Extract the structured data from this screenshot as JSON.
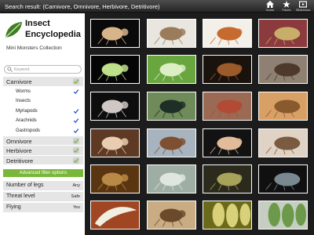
{
  "topbar": {
    "title": "Search result:  (Carnivore, Omnivore, Herbivore, Detritivore)",
    "buttons": [
      {
        "label": "Home",
        "icon": "home-icon"
      },
      {
        "label": "Faves",
        "icon": "star-icon"
      },
      {
        "label": "Slideshow",
        "icon": "slideshow-icon"
      }
    ]
  },
  "sidebar": {
    "logo_line1": "Insect",
    "logo_line2": "Encyclopedia",
    "collection": "Mini Monsters Collection",
    "search_placeholder": "Keyword",
    "categories": [
      {
        "label": "Carnivore",
        "checked": true,
        "type": "cat"
      },
      {
        "label": "Worms",
        "checked": true,
        "type": "sub"
      },
      {
        "label": "Insects",
        "checked": false,
        "type": "sub"
      },
      {
        "label": "Myriapods",
        "checked": true,
        "type": "sub"
      },
      {
        "label": "Arachnids",
        "checked": true,
        "type": "sub"
      },
      {
        "label": "Gastropods",
        "checked": true,
        "type": "sub"
      },
      {
        "label": "Omnivore",
        "checked": true,
        "type": "cat"
      },
      {
        "label": "Herbivore",
        "checked": true,
        "type": "cat"
      },
      {
        "label": "Detritivore",
        "checked": true,
        "type": "cat"
      }
    ],
    "advanced_label": "Advanced filter options",
    "filters": [
      {
        "label": "Number of legs",
        "value": "Any"
      },
      {
        "label": "Threat level",
        "value": "Safe"
      },
      {
        "label": "Flying",
        "value": "Yes"
      }
    ]
  },
  "results": [
    {
      "subject": "wasp",
      "bg": "#0a0a0a",
      "fg": "#d7b48a"
    },
    {
      "subject": "weevil",
      "bg": "#e9e6df",
      "fg": "#9a7b5a"
    },
    {
      "subject": "mite",
      "bg": "#f3f0ea",
      "fg": "#c66a2e"
    },
    {
      "subject": "moth-larva",
      "bg": "#8b3a3e",
      "fg": "#c9ae6a"
    },
    {
      "subject": "aphid",
      "bg": "#050505",
      "fg": "#bfe08a"
    },
    {
      "subject": "caterpillar",
      "bg": "#6aa640",
      "fg": "#ddeec4"
    },
    {
      "subject": "mollusc",
      "bg": "#1a120c",
      "fg": "#9a5a2a"
    },
    {
      "subject": "louse",
      "bg": "#8f8074",
      "fg": "#4d3a2c"
    },
    {
      "subject": "weevil",
      "bg": "#0d0d0d",
      "fg": "#cfc8c4"
    },
    {
      "subject": "beetle",
      "bg": "#6f8b5a",
      "fg": "#1f2e26"
    },
    {
      "subject": "ladybird",
      "bg": "#9a6a55",
      "fg": "#b24a35"
    },
    {
      "subject": "snail",
      "bg": "#d8a065",
      "fg": "#8a5a2f"
    },
    {
      "subject": "fly",
      "bg": "#5e3a25",
      "fg": "#e8cdb0"
    },
    {
      "subject": "bug",
      "bg": "#a7b4bf",
      "fg": "#7e4f30"
    },
    {
      "subject": "fly",
      "bg": "#121212",
      "fg": "#e2bc9a"
    },
    {
      "subject": "fly",
      "bg": "#e0d3c5",
      "fg": "#7a5a40"
    },
    {
      "subject": "larva-head",
      "bg": "#5a3512",
      "fg": "#b88a46"
    },
    {
      "subject": "scale",
      "bg": "#9faea4",
      "fg": "#dfe5df"
    },
    {
      "subject": "mite",
      "bg": "#2b2a1c",
      "fg": "#a7a35a"
    },
    {
      "subject": "beetle",
      "bg": "#101010",
      "fg": "#7a8890"
    },
    {
      "subject": "horn",
      "bg": "#a04622",
      "fg": "#f1efe2"
    },
    {
      "subject": "head",
      "bg": "#c9ab84",
      "fg": "#6a4a2a"
    },
    {
      "subject": "eggs",
      "bg": "#6b6a1a",
      "fg": "#d9d07a"
    },
    {
      "subject": "pod",
      "bg": "#c6cec2",
      "fg": "#6d9a4a"
    }
  ]
}
